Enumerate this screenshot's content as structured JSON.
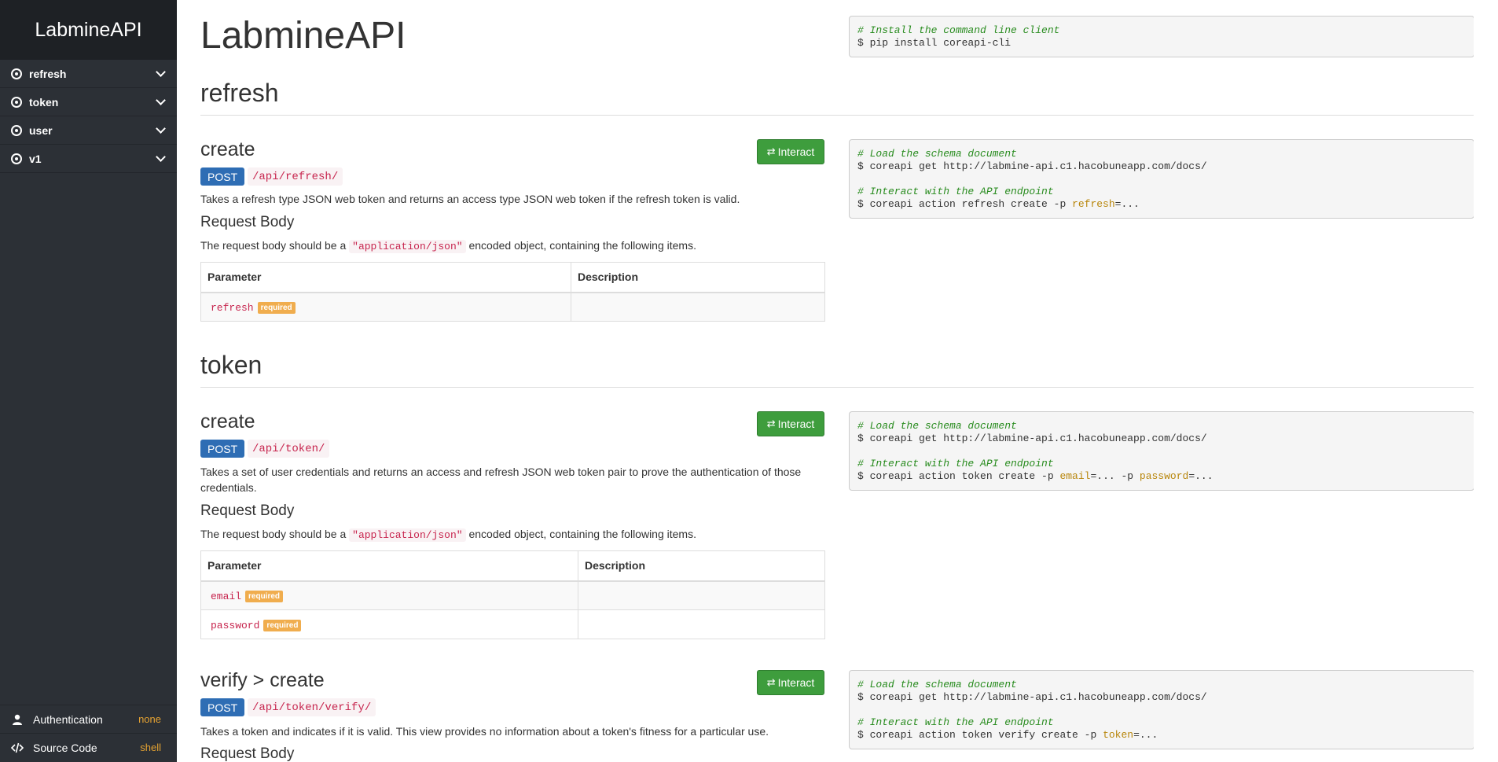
{
  "app": {
    "title": "LabmineAPI"
  },
  "sidebar": {
    "items": [
      {
        "label": "refresh"
      },
      {
        "label": "token"
      },
      {
        "label": "user"
      },
      {
        "label": "v1"
      }
    ],
    "footer": {
      "auth_label": "Authentication",
      "auth_value": "none",
      "source_label": "Source Code",
      "source_value": "shell"
    }
  },
  "install": {
    "comment": "# Install the command line client",
    "command": "$ pip install coreapi-cli"
  },
  "common": {
    "interact_label": "Interact",
    "method": "POST",
    "request_body_title": "Request Body",
    "request_body_prefix": "The request body should be a",
    "request_body_type": "\"application/json\"",
    "request_body_suffix": "encoded object, containing the following items.",
    "col_parameter": "Parameter",
    "col_description": "Description",
    "required_badge": "required",
    "load_comment": "# Load the schema document",
    "load_command": "$ coreapi get http://labmine-api.c1.hacobuneapp.com/docs/",
    "interact_comment": "# Interact with the API endpoint"
  },
  "sections": [
    {
      "title": "refresh",
      "endpoints": [
        {
          "name": "create",
          "path": "/api/refresh/",
          "description": "Takes a refresh type JSON web token and returns an access type JSON web token if the refresh token is valid.",
          "params": [
            "refresh"
          ],
          "cmd_prefix": "$ coreapi action refresh create -p ",
          "cmd_params": [
            "refresh"
          ]
        }
      ]
    },
    {
      "title": "token",
      "endpoints": [
        {
          "name": "create",
          "path": "/api/token/",
          "description": "Takes a set of user credentials and returns an access and refresh JSON web token pair to prove the authentication of those credentials.",
          "params": [
            "email",
            "password"
          ],
          "cmd_prefix": "$ coreapi action token create -p ",
          "cmd_params": [
            "email",
            "password"
          ]
        },
        {
          "name": "verify > create",
          "path": "/api/token/verify/",
          "description": "Takes a token and indicates if it is valid. This view provides no information about a token's fitness for a particular use.",
          "cmd_prefix": "$ coreapi action token verify create -p ",
          "cmd_params": [
            "token"
          ]
        }
      ]
    }
  ],
  "colors": {
    "sidebar_bg": "#2c3036",
    "brand_bg": "#1e2125",
    "interact_green": "#3e9d3d",
    "post_blue": "#2e6db4",
    "required_orange": "#f0ad4e",
    "code_red": "#c7254e"
  }
}
